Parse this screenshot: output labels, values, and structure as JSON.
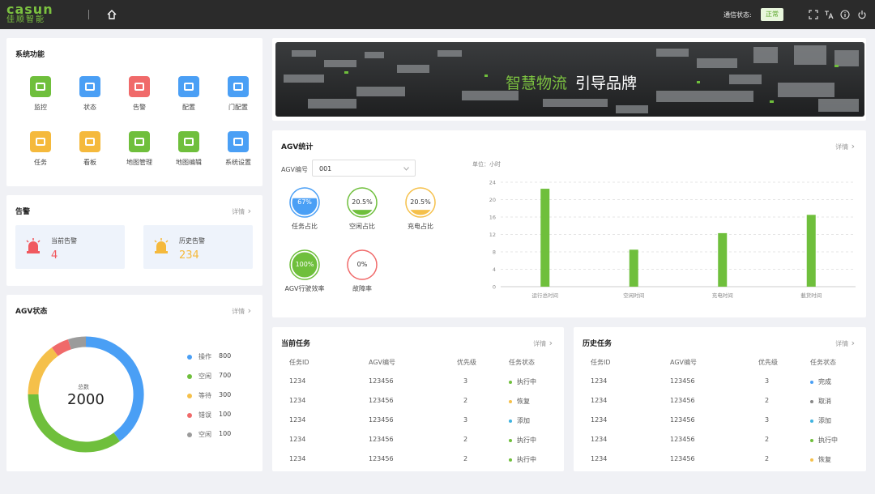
{
  "header": {
    "logo_en": "casun",
    "logo_cn": "佳顺智能",
    "comm_label": "通信状态:",
    "comm_status": "正常"
  },
  "system_functions": {
    "title": "系统功能",
    "items": [
      {
        "label": "监控",
        "color": "#6fbf3c",
        "icon": "monitor-icon"
      },
      {
        "label": "状态",
        "color": "#4a9ff5",
        "icon": "pulse-icon"
      },
      {
        "label": "告警",
        "color": "#f06a6a",
        "icon": "alarm-icon"
      },
      {
        "label": "配置",
        "color": "#4a9ff5",
        "icon": "config-icon"
      },
      {
        "label": "门配置",
        "color": "#4a9ff5",
        "icon": "door-icon"
      },
      {
        "label": "任务",
        "color": "#f5b93c",
        "icon": "clipboard-icon"
      },
      {
        "label": "看板",
        "color": "#f5b93c",
        "icon": "board-icon"
      },
      {
        "label": "地图管理",
        "color": "#6fbf3c",
        "icon": "map-icon"
      },
      {
        "label": "地图编辑",
        "color": "#6fbf3c",
        "icon": "map-edit-icon"
      },
      {
        "label": "系统设置",
        "color": "#4a9ff5",
        "icon": "gear-icon"
      }
    ]
  },
  "alarm": {
    "title": "告警",
    "detail": "详情",
    "current": {
      "label": "当前告警",
      "value": "4",
      "color": "#f0595f"
    },
    "history": {
      "label": "历史告警",
      "value": "234",
      "color": "#f5b93c"
    }
  },
  "agv_status": {
    "title": "AGV状态",
    "detail": "详情",
    "total_label": "总数",
    "total": "2000",
    "legend": [
      {
        "name": "操作",
        "value": "800",
        "color": "#4a9ff5"
      },
      {
        "name": "空闲",
        "value": "700",
        "color": "#6fbf3c"
      },
      {
        "name": "等待",
        "value": "300",
        "color": "#f5c04a"
      },
      {
        "name": "错误",
        "value": "100",
        "color": "#f06a6a"
      },
      {
        "name": "空闲",
        "value": "100",
        "color": "#9b9b9b"
      }
    ]
  },
  "banner": {
    "text_green": "智慧物流",
    "text_white": "引导品牌"
  },
  "agv_stats": {
    "title": "AGV统计",
    "detail": "详情",
    "agv_no_label": "AGV编号",
    "agv_no_value": "001",
    "unit": "单位：小时",
    "gauges": [
      {
        "value": "67%",
        "label": "任务占比",
        "color": "#4a9ff5",
        "fill": 0.67
      },
      {
        "value": "20.5%",
        "label": "空闲占比",
        "color": "#6fbf3c",
        "fill": 0.205
      },
      {
        "value": "20.5%",
        "label": "充电占比",
        "color": "#f5c04a",
        "fill": 0.205
      },
      {
        "value": "100%",
        "label": "AGV行驶效率",
        "color": "#6fbf3c",
        "fill": 1.0
      },
      {
        "value": "0%",
        "label": "故障率",
        "color": "#f06a6a",
        "fill": 0
      }
    ]
  },
  "chart_data": {
    "type": "bar",
    "categories": [
      "运行总时间",
      "空闲时间",
      "充电时间",
      "載货时间"
    ],
    "values": [
      22.5,
      8.5,
      12.3,
      16.5
    ],
    "ylim": [
      0,
      24
    ],
    "yticks": [
      0,
      4,
      8,
      12,
      16,
      20,
      24
    ],
    "color": "#6fbf3c",
    "grid": true
  },
  "current_tasks": {
    "title": "当前任务",
    "detail": "详情",
    "headers": [
      "任务ID",
      "AGV编号",
      "优先级",
      "任务状态"
    ],
    "rows": [
      {
        "id": "1234",
        "agv": "123456",
        "priority": "3",
        "status": "执行中",
        "color": "#6fbf3c"
      },
      {
        "id": "1234",
        "agv": "123456",
        "priority": "2",
        "status": "恢复",
        "color": "#f5c04a"
      },
      {
        "id": "1234",
        "agv": "123456",
        "priority": "3",
        "status": "添加",
        "color": "#3fb3e0"
      },
      {
        "id": "1234",
        "agv": "123456",
        "priority": "2",
        "status": "执行中",
        "color": "#6fbf3c"
      },
      {
        "id": "1234",
        "agv": "123456",
        "priority": "2",
        "status": "执行中",
        "color": "#6fbf3c"
      }
    ]
  },
  "history_tasks": {
    "title": "历史任务",
    "detail": "详情",
    "headers": [
      "任务ID",
      "AGV编号",
      "优先级",
      "任务状态"
    ],
    "rows": [
      {
        "id": "1234",
        "agv": "123456",
        "priority": "3",
        "status": "完成",
        "color": "#4a9ff5"
      },
      {
        "id": "1234",
        "agv": "123456",
        "priority": "2",
        "status": "取消",
        "color": "#888888"
      },
      {
        "id": "1234",
        "agv": "123456",
        "priority": "3",
        "status": "添加",
        "color": "#3fb3e0"
      },
      {
        "id": "1234",
        "agv": "123456",
        "priority": "2",
        "status": "执行中",
        "color": "#6fbf3c"
      },
      {
        "id": "1234",
        "agv": "123456",
        "priority": "2",
        "status": "恢复",
        "color": "#f5c04a"
      }
    ]
  }
}
